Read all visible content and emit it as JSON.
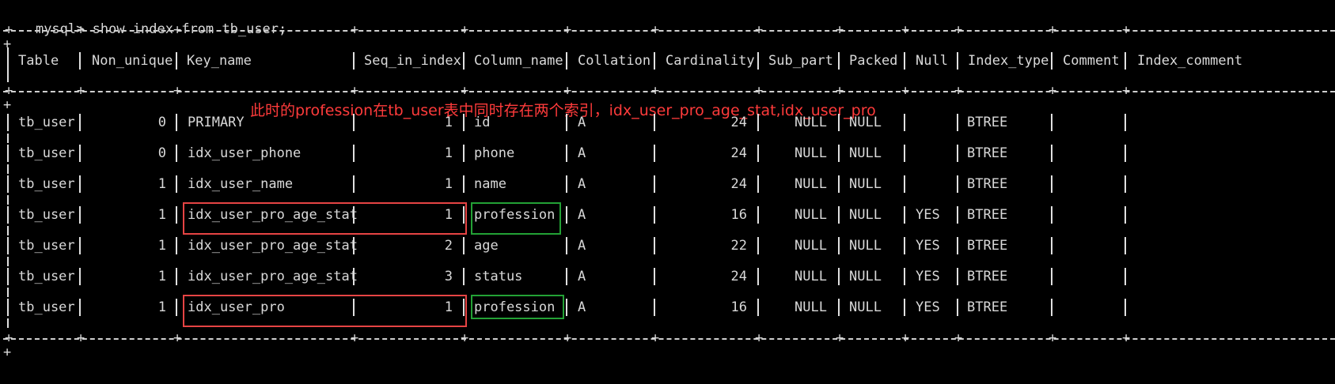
{
  "prompt": "mysql>",
  "command": "show index from tb_user;",
  "columns": [
    "Table",
    "Non_unique",
    "Key_name",
    "Seq_in_index",
    "Column_name",
    "Collation",
    "Cardinality",
    "Sub_part",
    "Packed",
    "Null",
    "Index_type",
    "Comment",
    "Index_comment"
  ],
  "rows": [
    {
      "table": "tb_user",
      "non_unique": "0",
      "key_name": "PRIMARY",
      "seq": "1",
      "column": "id",
      "collation": "A",
      "cardinality": "24",
      "sub_part": "NULL",
      "packed": "NULL",
      "null": "",
      "index_type": "BTREE"
    },
    {
      "table": "tb_user",
      "non_unique": "0",
      "key_name": "idx_user_phone",
      "seq": "1",
      "column": "phone",
      "collation": "A",
      "cardinality": "24",
      "sub_part": "NULL",
      "packed": "NULL",
      "null": "",
      "index_type": "BTREE"
    },
    {
      "table": "tb_user",
      "non_unique": "1",
      "key_name": "idx_user_name",
      "seq": "1",
      "column": "name",
      "collation": "A",
      "cardinality": "24",
      "sub_part": "NULL",
      "packed": "NULL",
      "null": "",
      "index_type": "BTREE"
    },
    {
      "table": "tb_user",
      "non_unique": "1",
      "key_name": "idx_user_pro_age_stat",
      "seq": "1",
      "column": "profession",
      "collation": "A",
      "cardinality": "16",
      "sub_part": "NULL",
      "packed": "NULL",
      "null": "YES",
      "index_type": "BTREE"
    },
    {
      "table": "tb_user",
      "non_unique": "1",
      "key_name": "idx_user_pro_age_stat",
      "seq": "2",
      "column": "age",
      "collation": "A",
      "cardinality": "22",
      "sub_part": "NULL",
      "packed": "NULL",
      "null": "YES",
      "index_type": "BTREE"
    },
    {
      "table": "tb_user",
      "non_unique": "1",
      "key_name": "idx_user_pro_age_stat",
      "seq": "3",
      "column": "status",
      "collation": "A",
      "cardinality": "24",
      "sub_part": "NULL",
      "packed": "NULL",
      "null": "YES",
      "index_type": "BTREE"
    },
    {
      "table": "tb_user",
      "non_unique": "1",
      "key_name": "idx_user_pro",
      "seq": "1",
      "column": "profession",
      "collation": "A",
      "cardinality": "16",
      "sub_part": "NULL",
      "packed": "NULL",
      "null": "YES",
      "index_type": "BTREE"
    }
  ],
  "annotation": "此时的profession在tb_user表中同时存在两个索引，idx_user_pro_age_stat,idx_user_pro",
  "colors": {
    "background": "#000000",
    "text": "#d9d9d9",
    "annotation": "#ff3b3b",
    "highlight_key": "#e64444",
    "highlight_column": "#23a135"
  }
}
